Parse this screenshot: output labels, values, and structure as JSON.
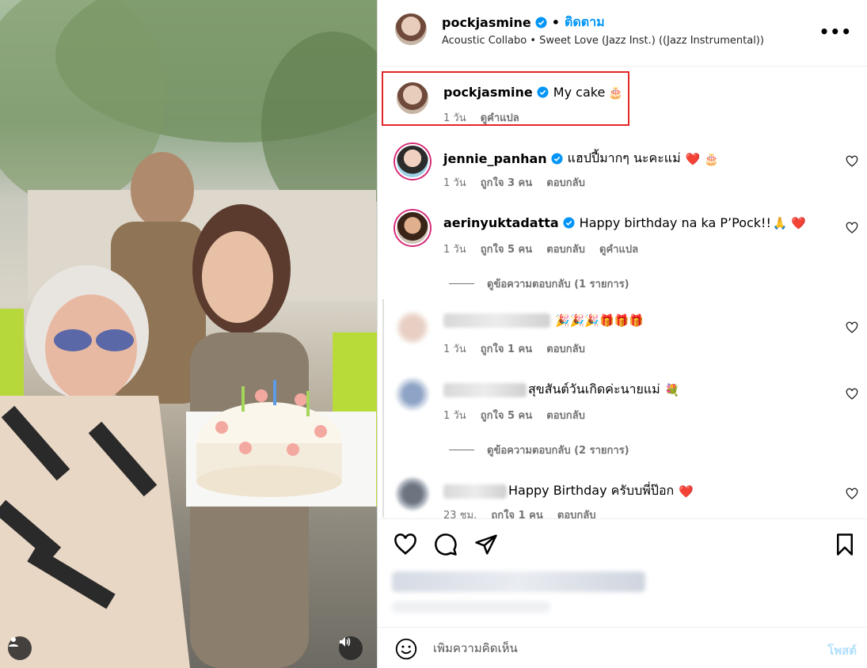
{
  "header": {
    "username": "pockjasmine",
    "separator": "•",
    "follow_label": "ติดตาม",
    "audio_artist": "Acoustic Collabo",
    "audio_sep": " • ",
    "audio_title": "Sweet Love (Jazz Inst.) ((Jazz Instrumental))",
    "more_label": "•••"
  },
  "caption": {
    "username": "pockjasmine",
    "text": "My cake",
    "emoji": "🎂",
    "time": "1 วัน",
    "translate": "ดูคำแปล"
  },
  "comments": [
    {
      "username": "jennie_panhan",
      "text": "แฮปปี้มากๆ นะคะแม่",
      "emoji": "❤️ 🎂",
      "time": "1 วัน",
      "likes": "ถูกใจ 3 คน",
      "reply": "ตอบกลับ"
    },
    {
      "username": "aerinyuktadatta",
      "text": "Happy birthday na ka P’Pock!!",
      "emoji": "🙏 ❤️",
      "time": "1 วัน",
      "likes": "ถูกใจ 5 คน",
      "reply": "ตอบกลับ",
      "translate": "ดูคำแปล"
    },
    {
      "text": "",
      "emoji": "🎉🎉🎉🎁🎁🎁",
      "time": "1 วัน",
      "likes": "ถูกใจ 1 คน",
      "reply": "ตอบกลับ"
    },
    {
      "text": "สุขสันต์วันเกิดค่ะนายแม่",
      "emoji": "💐",
      "time": "1 วัน",
      "likes": "ถูกใจ 5 คน",
      "reply": "ตอบกลับ"
    },
    {
      "text": "Happy Birthday ครับบพี่ป๊อก",
      "emoji": "❤️",
      "time": "23 ชม.",
      "likes": "ถูกใจ 1 คน",
      "reply": "ตอบกลับ"
    }
  ],
  "view_replies": [
    "ดูข้อความตอบกลับ (1 รายการ)",
    "ดูข้อความตอบกลับ (2 รายการ)"
  ],
  "add_comment": {
    "placeholder": "เพิ่มความคิดเห็น",
    "post_label": "โพสต์"
  },
  "colors": {
    "accent": "#0095f6",
    "highlight_border": "#e32626",
    "meta_text": "#737373"
  }
}
